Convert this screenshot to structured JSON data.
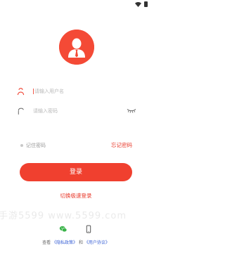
{
  "colors": {
    "brand": "#f0402f",
    "link": "#3c63d6",
    "placeholder": "#b9b9b9"
  },
  "status_bar": {
    "icons": [
      "wifi-icon",
      "battery-icon"
    ]
  },
  "avatar": {
    "icon": "user-avatar-icon"
  },
  "login_form": {
    "username_placeholder": "请输入用户名",
    "password_placeholder": "请输入密码",
    "remember_label": "记住密码",
    "forgot_label": "忘记密码",
    "login_button": "登录",
    "quick_login": "切换极速登录"
  },
  "watermark": "手游5599 www.5599.com",
  "social": {
    "icons": [
      "wechat-icon",
      "phone-icon"
    ]
  },
  "agreement": {
    "prefix": "查看",
    "privacy": "《隐私政策》",
    "and": "和",
    "user": "《用户协议》"
  }
}
